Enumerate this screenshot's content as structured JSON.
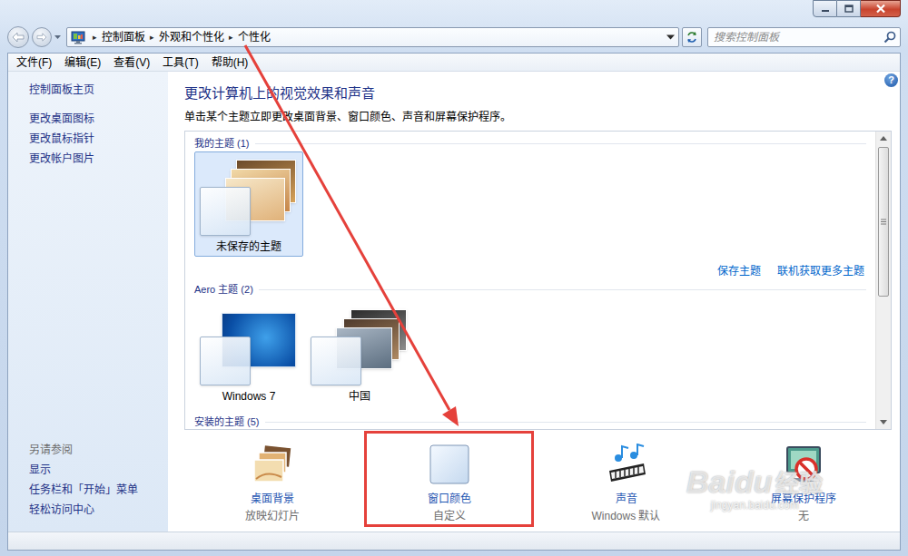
{
  "address": {
    "separator": "▸",
    "breadcrumb": [
      "控制面板",
      "外观和个性化",
      "个性化"
    ]
  },
  "search": {
    "placeholder": "搜索控制面板"
  },
  "menu": [
    "文件(F)",
    "编辑(E)",
    "查看(V)",
    "工具(T)",
    "帮助(H)"
  ],
  "sidebar": {
    "links": [
      "控制面板主页",
      "更改桌面图标",
      "更改鼠标指针",
      "更改帐户图片"
    ],
    "see_also": {
      "title": "另请参阅",
      "links": [
        "显示",
        "任务栏和「开始」菜单",
        "轻松访问中心"
      ]
    }
  },
  "main": {
    "heading": "更改计算机上的视觉效果和声音",
    "description": "单击某个主题立即更改桌面背景、窗口颜色、声音和屏幕保护程序。",
    "help": "?"
  },
  "themes": {
    "groups": [
      {
        "title": "我的主题 (1)",
        "items": [
          {
            "label": "未保存的主题",
            "selected": true
          }
        ],
        "links": [
          "保存主题",
          "联机获取更多主题"
        ]
      },
      {
        "title": "Aero 主题 (2)",
        "items": [
          {
            "label": "Windows 7",
            "selected": false
          },
          {
            "label": "中国",
            "selected": false
          }
        ],
        "links": []
      },
      {
        "title": "安装的主题 (5)",
        "items": [],
        "links": []
      }
    ]
  },
  "settings": [
    {
      "label": "桌面背景",
      "value": "放映幻灯片",
      "highlighted": false
    },
    {
      "label": "窗口颜色",
      "value": "自定义",
      "highlighted": true
    },
    {
      "label": "声音",
      "value": "Windows 默认",
      "highlighted": false
    },
    {
      "label": "屏幕保护程序",
      "value": "无",
      "highlighted": false
    }
  ],
  "watermark": {
    "brand": "Baidu",
    "label": "经验",
    "url": "jingyan.baidu.com"
  }
}
